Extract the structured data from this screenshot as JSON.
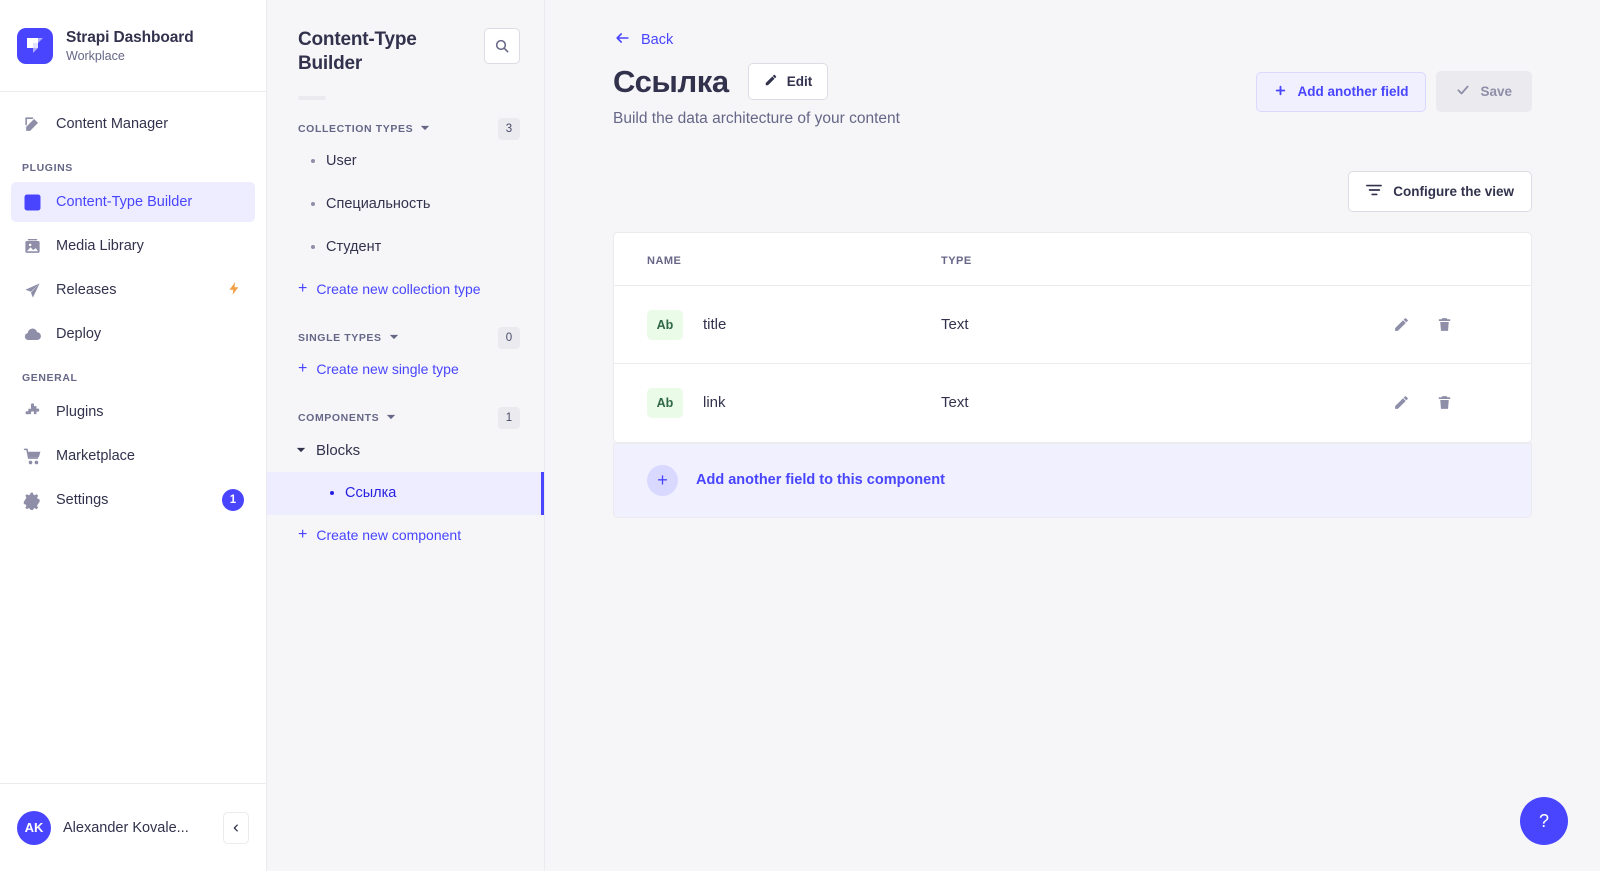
{
  "brand": {
    "title": "Strapi Dashboard",
    "subtitle": "Workplace",
    "logo_color": "#4945ff"
  },
  "sidebar": {
    "top_items": [
      {
        "label": "Content Manager",
        "icon": "pen-square-icon",
        "active": false
      }
    ],
    "sections": [
      {
        "title": "PLUGINS",
        "items": [
          {
            "label": "Content-Type Builder",
            "icon": "layout-grid-icon",
            "active": true
          },
          {
            "label": "Media Library",
            "icon": "image-icon",
            "active": false
          },
          {
            "label": "Releases",
            "icon": "paper-plane-icon",
            "active": false,
            "badge_icon": "lightning-bolt-icon"
          },
          {
            "label": "Deploy",
            "icon": "cloud-icon",
            "active": false
          }
        ]
      },
      {
        "title": "GENERAL",
        "items": [
          {
            "label": "Plugins",
            "icon": "puzzle-icon",
            "active": false
          },
          {
            "label": "Marketplace",
            "icon": "shopping-cart-icon",
            "active": false
          },
          {
            "label": "Settings",
            "icon": "gear-icon",
            "active": false,
            "badge": "1"
          }
        ]
      }
    ],
    "user": {
      "initials": "AK",
      "name": "Alexander Kovale...",
      "collapse_icon": "chevron-left-icon"
    }
  },
  "ctb_panel": {
    "title": "Content-Type Builder",
    "search_icon": "search-icon",
    "groups": [
      {
        "title": "COLLECTION TYPES",
        "count": "3",
        "items": [
          {
            "label": "User",
            "selected": false
          },
          {
            "label": "Специальность",
            "selected": false
          },
          {
            "label": "Студент",
            "selected": false
          }
        ],
        "create_label": "Create new collection type"
      },
      {
        "title": "SINGLE TYPES",
        "count": "0",
        "items": [],
        "create_label": "Create new single type"
      },
      {
        "title": "COMPONENTS",
        "count": "1",
        "category": "Blocks",
        "items": [
          {
            "label": "Ссылка",
            "selected": true
          }
        ],
        "create_label": "Create new component"
      }
    ]
  },
  "main": {
    "back_label": "Back",
    "page_title": "Ссылка",
    "edit_label": "Edit",
    "subtitle": "Build the data architecture of your content",
    "add_field_label": "Add another field",
    "save_label": "Save",
    "save_disabled": true,
    "configure_label": "Configure the view",
    "table": {
      "columns": [
        "NAME",
        "TYPE"
      ],
      "rows": [
        {
          "chip": "Ab",
          "name": "title",
          "type": "Text",
          "edit_icon": "pencil-icon",
          "delete_icon": "trash-icon"
        },
        {
          "chip": "Ab",
          "name": "link",
          "type": "Text",
          "edit_icon": "pencil-icon",
          "delete_icon": "trash-icon"
        }
      ]
    },
    "footer_action": "Add another field to this component",
    "help_label": "?"
  },
  "colors": {
    "primary": "#4945ff",
    "primary_dark": "#271fe0",
    "primary_light": "#f0f0ff",
    "neutral_text": "#32324d",
    "neutral_muted": "#666687",
    "surface": "#f6f6f9",
    "border": "#eaeaef",
    "success_bg": "#eafbe7",
    "success_text": "#2f6846",
    "warning": "#f29d41"
  }
}
